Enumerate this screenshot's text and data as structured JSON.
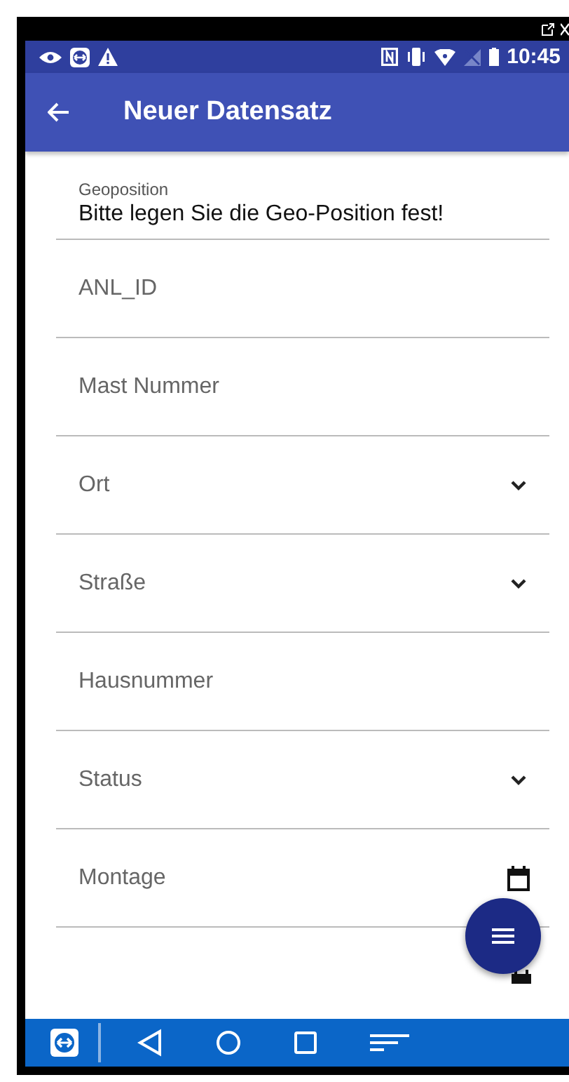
{
  "status_bar": {
    "time": "10:45"
  },
  "app_bar": {
    "title": "Neuer Datensatz"
  },
  "geoposition": {
    "label": "Geoposition",
    "value": "Bitte legen Sie die Geo-Position fest!"
  },
  "fields": [
    {
      "kind": "text",
      "placeholder": "ANL_ID"
    },
    {
      "kind": "text",
      "placeholder": "Mast Nummer"
    },
    {
      "kind": "select",
      "placeholder": "Ort"
    },
    {
      "kind": "select",
      "placeholder": "Straße"
    },
    {
      "kind": "text",
      "placeholder": "Hausnummer"
    },
    {
      "kind": "select",
      "placeholder": "Status"
    },
    {
      "kind": "date",
      "placeholder": "Montage"
    },
    {
      "kind": "date"
    }
  ]
}
